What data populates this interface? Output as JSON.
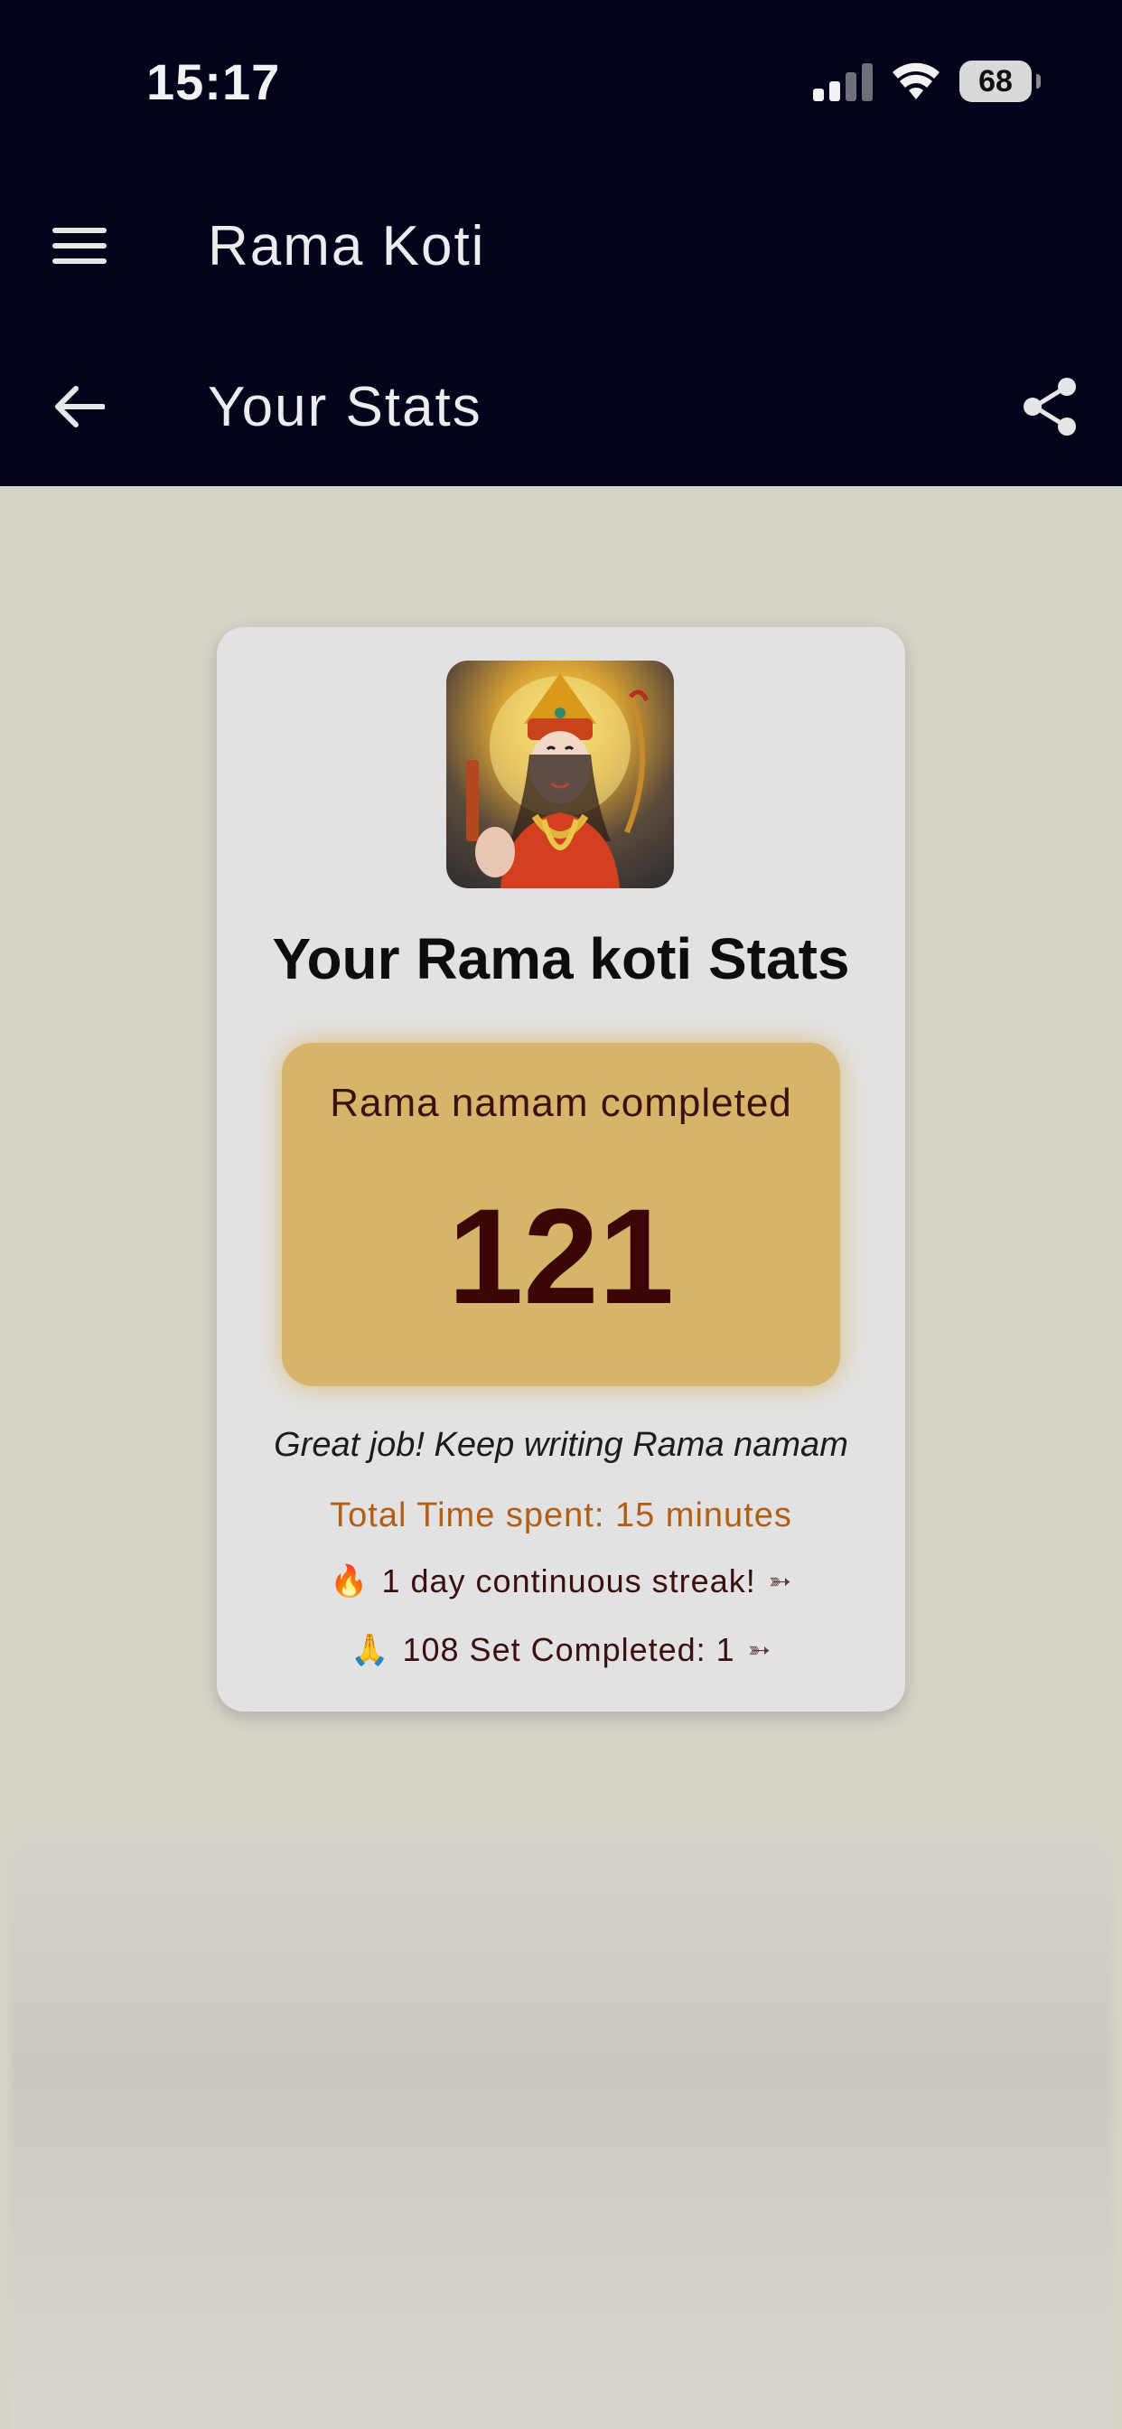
{
  "status_bar": {
    "time": "15:17",
    "battery": "68"
  },
  "app_bar": {
    "title": "Rama Koti"
  },
  "sub_bar": {
    "title": "Your Stats"
  },
  "card": {
    "title": "Your Rama koti Stats",
    "count_label": "Rama namam completed",
    "count_value": "121",
    "encouragement": "Great job! Keep writing Rama namam",
    "time_spent": "Total Time spent: 15 minutes",
    "streak_text": "1 day continuous streak!",
    "sets_text": "108 Set Completed: 1"
  },
  "colors": {
    "top_bg": "#03031c",
    "page_bg": "#d6d3c8",
    "card_bg": "#e2e2e2",
    "count_box": "#d6b46a",
    "count_text": "#3c0606",
    "time_text": "#b35e15"
  },
  "icons": {
    "menu": "hamburger-menu-icon",
    "back": "back-arrow-icon",
    "share": "share-icon",
    "fire": "fire-emoji",
    "pray": "folded-hands-emoji",
    "arrow": "bow-arrow-icon"
  }
}
